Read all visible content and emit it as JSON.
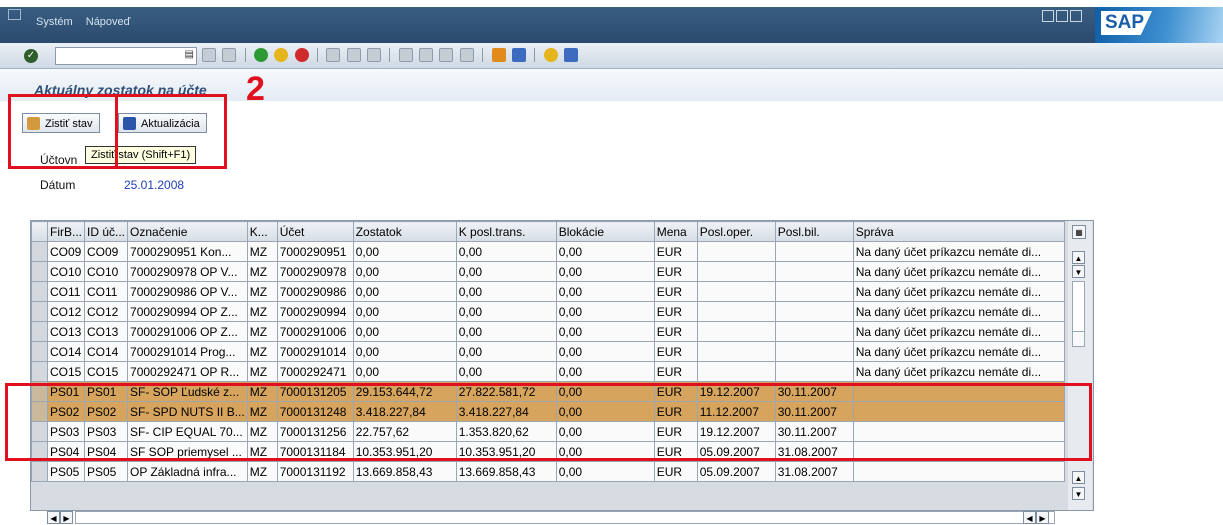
{
  "menu": [
    "Systém",
    "Nápoveď"
  ],
  "sap_logo": "SAP",
  "command_field": {
    "value": ""
  },
  "title": "Aktuálny zostatok na účte",
  "buttons": {
    "zistit": "Zistiť stav",
    "aktualizacia": "Aktualizácia"
  },
  "tooltip": "Zistiť stav   (Shift+F1)",
  "annotation_number": "2",
  "form": {
    "ucet_label": "Účtovn",
    "datum_label": "Dátum",
    "datum_value": "25.01.2008"
  },
  "table": {
    "columns": [
      "FirB...",
      "ID úč...",
      "Označenie",
      "K...",
      "Účet",
      "Zostatok",
      "K posl.trans.",
      "Blokácie",
      "Mena",
      "Posl.oper.",
      "Posl.bil.",
      "Správa"
    ],
    "rows": [
      [
        "CO09",
        "CO09",
        "7000290951 Kon...",
        "MZ",
        "7000290951",
        "0,00",
        "0,00",
        "0,00",
        "EUR",
        "",
        "",
        "Na daný účet príkazcu nemáte di..."
      ],
      [
        "CO10",
        "CO10",
        "7000290978 OP V...",
        "MZ",
        "7000290978",
        "0,00",
        "0,00",
        "0,00",
        "EUR",
        "",
        "",
        "Na daný účet príkazcu nemáte di..."
      ],
      [
        "CO11",
        "CO11",
        "7000290986 OP V...",
        "MZ",
        "7000290986",
        "0,00",
        "0,00",
        "0,00",
        "EUR",
        "",
        "",
        "Na daný účet príkazcu nemáte di..."
      ],
      [
        "CO12",
        "CO12",
        "7000290994 OP Z...",
        "MZ",
        "7000290994",
        "0,00",
        "0,00",
        "0,00",
        "EUR",
        "",
        "",
        "Na daný účet príkazcu nemáte di..."
      ],
      [
        "CO13",
        "CO13",
        "7000291006 OP Z...",
        "MZ",
        "7000291006",
        "0,00",
        "0,00",
        "0,00",
        "EUR",
        "",
        "",
        "Na daný účet príkazcu nemáte di..."
      ],
      [
        "CO14",
        "CO14",
        "7000291014 Prog...",
        "MZ",
        "7000291014",
        "0,00",
        "0,00",
        "0,00",
        "EUR",
        "",
        "",
        "Na daný účet príkazcu nemáte di..."
      ],
      [
        "CO15",
        "CO15",
        "7000292471 OP R...",
        "MZ",
        "7000292471",
        "0,00",
        "0,00",
        "0,00",
        "EUR",
        "",
        "",
        "Na daný účet príkazcu nemáte di..."
      ],
      [
        "PS01",
        "PS01",
        "SF- SOP Ľudské z...",
        "MZ",
        "7000131205",
        "29.153.644,72",
        "27.822.581,72",
        "0,00",
        "EUR",
        "19.12.2007",
        "30.11.2007",
        ""
      ],
      [
        "PS02",
        "PS02",
        "SF- SPD NUTS II B...",
        "MZ",
        "7000131248",
        "3.418.227,84",
        "3.418.227,84",
        "0,00",
        "EUR",
        "11.12.2007",
        "30.11.2007",
        ""
      ],
      [
        "PS03",
        "PS03",
        "SF- CIP EQUAL 70...",
        "MZ",
        "7000131256",
        "22.757,62",
        "1.353.820,62",
        "0,00",
        "EUR",
        "19.12.2007",
        "30.11.2007",
        ""
      ],
      [
        "PS04",
        "PS04",
        "SF SOP priemysel ...",
        "MZ",
        "7000131184",
        "10.353.951,20",
        "10.353.951,20",
        "0,00",
        "EUR",
        "05.09.2007",
        "31.08.2007",
        ""
      ],
      [
        "PS05",
        "PS05",
        "OP Základná infra...",
        "MZ",
        "7000131192",
        "13.669.858,43",
        "13.669.858,43",
        "0,00",
        "EUR",
        "05.09.2007",
        "31.08.2007",
        ""
      ]
    ],
    "highlighted_rows": [
      7,
      8
    ]
  },
  "colors": {
    "highlight": "#d6a45c",
    "annotation": "#e0101e",
    "title": "#2e4f78",
    "date": "#1f3fb8"
  }
}
